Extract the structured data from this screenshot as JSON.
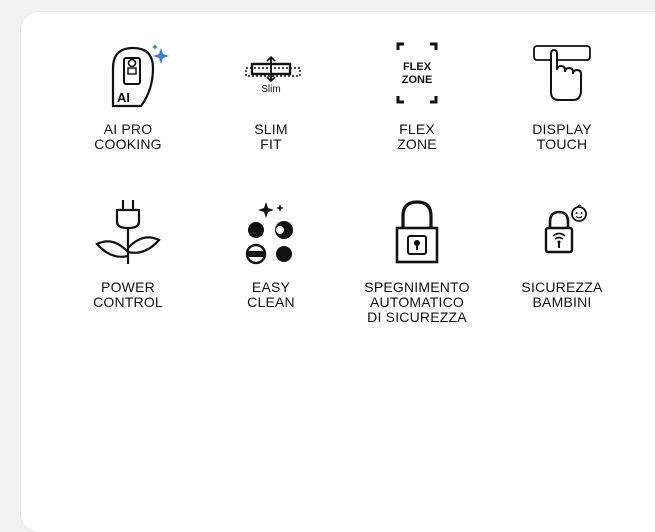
{
  "features": [
    {
      "icon": "ai-pro-cooking-icon",
      "lines": [
        "AI PRO",
        "COOKING"
      ],
      "badge": "AI"
    },
    {
      "icon": "slim-fit-icon",
      "lines": [
        "SLIM",
        "FIT"
      ],
      "badge": "Slim"
    },
    {
      "icon": "flex-zone-icon",
      "lines": [
        "FLEX",
        "ZONE"
      ],
      "badge_lines": [
        "FLEX",
        "ZONE"
      ]
    },
    {
      "icon": "display-touch-icon",
      "lines": [
        "DISPLAY",
        "TOUCH"
      ]
    },
    {
      "icon": "power-control-icon",
      "lines": [
        "POWER",
        "CONTROL"
      ]
    },
    {
      "icon": "easy-clean-icon",
      "lines": [
        "EASY",
        "CLEAN"
      ]
    },
    {
      "icon": "lock-icon",
      "lines": [
        "SPEGNIMENTO",
        "AUTOMATICO",
        "DI SICUREZZA"
      ]
    },
    {
      "icon": "child-lock-icon",
      "lines": [
        "SICUREZZA",
        "BAMBINI"
      ]
    }
  ]
}
